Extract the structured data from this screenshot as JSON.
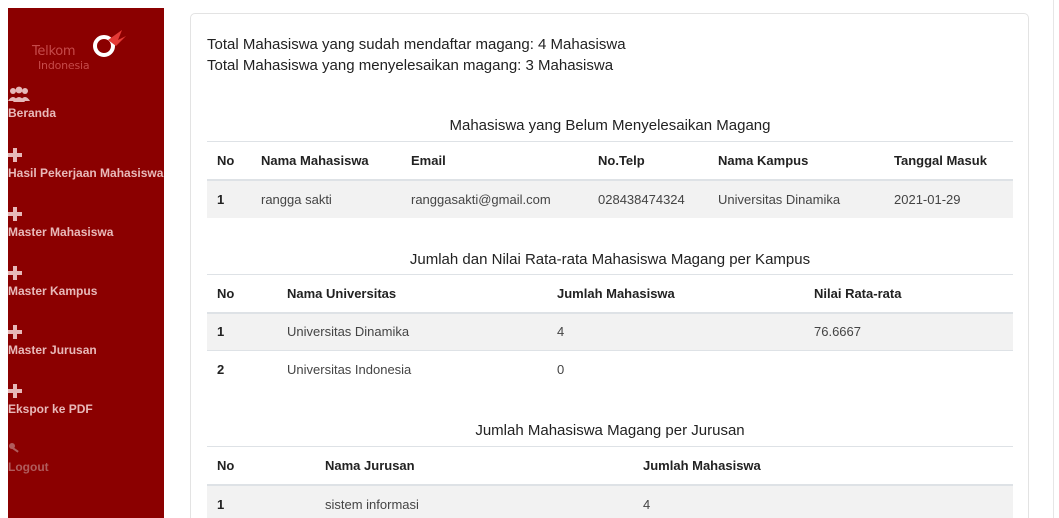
{
  "sidebar": {
    "logo": {
      "line1": "Telkom",
      "line2": "Indonesia"
    },
    "items": [
      {
        "icon": "users-icon",
        "label": "Beranda"
      },
      {
        "icon": "plus-icon",
        "label": "Hasil Pekerjaan Mahasiswa"
      },
      {
        "icon": "plus-icon",
        "label": "Master Mahasiswa"
      },
      {
        "icon": "plus-icon",
        "label": "Master Kampus"
      },
      {
        "icon": "plus-icon",
        "label": "Master Jurusan"
      },
      {
        "icon": "plus-icon",
        "label": "Ekspor ke PDF"
      },
      {
        "icon": "key-icon",
        "label": "Logout"
      }
    ],
    "color": "#8b0000"
  },
  "summary": {
    "registered": "Total Mahasiswa yang sudah mendaftar magang: 4 Mahasiswa",
    "completed": "Total Mahasiswa yang menyelesaikan magang: 3 Mahasiswa"
  },
  "table1": {
    "title": "Mahasiswa yang Belum Menyelesaikan Magang",
    "headers": [
      "No",
      "Nama Mahasiswa",
      "Email",
      "No.Telp",
      "Nama Kampus",
      "Tanggal Masuk"
    ],
    "rows": [
      [
        "1",
        "rangga sakti",
        "ranggasakti@gmail.com",
        "028438474324",
        "Universitas Dinamika",
        "2021-01-29"
      ]
    ]
  },
  "table2": {
    "title": "Jumlah dan Nilai Rata-rata Mahasiswa Magang per Kampus",
    "headers": [
      "No",
      "Nama Universitas",
      "Jumlah Mahasiswa",
      "Nilai Rata-rata"
    ],
    "rows": [
      [
        "1",
        "Universitas Dinamika",
        "4",
        "76.6667"
      ],
      [
        "2",
        "Universitas Indonesia",
        "0",
        ""
      ]
    ]
  },
  "table3": {
    "title": "Jumlah Mahasiswa Magang per Jurusan",
    "headers": [
      "No",
      "Nama Jurusan",
      "Jumlah Mahasiswa"
    ],
    "rows": [
      [
        "1",
        "sistem informasi",
        "4"
      ]
    ]
  }
}
